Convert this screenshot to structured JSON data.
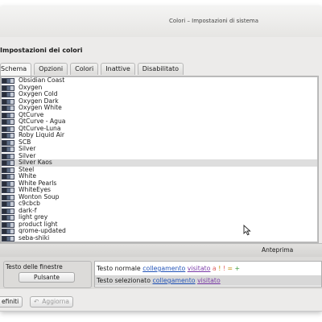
{
  "window": {
    "title": "Colori – Impostazioni di sistema"
  },
  "heading": "Impostazioni dei colori",
  "tabs": [
    {
      "label": "Schema",
      "active": true
    },
    {
      "label": "Opzioni",
      "active": false
    },
    {
      "label": "Colori",
      "active": false
    },
    {
      "label": "Inattive",
      "active": false
    },
    {
      "label": "Disabilitato",
      "active": false
    }
  ],
  "schemes": [
    {
      "name": "Obsidian Coast",
      "selected": false
    },
    {
      "name": "Oxygen",
      "selected": false
    },
    {
      "name": "Oxygen Cold",
      "selected": false
    },
    {
      "name": "Oxygen Dark",
      "selected": false
    },
    {
      "name": "Oxygen White",
      "selected": false
    },
    {
      "name": "QtCurve",
      "selected": false
    },
    {
      "name": "QtCurve - Agua",
      "selected": false
    },
    {
      "name": "QtCurve-Luna",
      "selected": false
    },
    {
      "name": "Roby Liquid Air",
      "selected": false
    },
    {
      "name": "SCB",
      "selected": false
    },
    {
      "name": "Silver",
      "selected": false
    },
    {
      "name": "Silver",
      "selected": false
    },
    {
      "name": "Silver Kaos",
      "selected": true
    },
    {
      "name": "Steel",
      "selected": false
    },
    {
      "name": "White",
      "selected": false
    },
    {
      "name": "White Pearls",
      "selected": false
    },
    {
      "name": "WhiteEyes",
      "selected": false
    },
    {
      "name": "Wonton Soup",
      "selected": false
    },
    {
      "name": "c9cbcb",
      "selected": false
    },
    {
      "name": "dark-f",
      "selected": false
    },
    {
      "name": "light grey",
      "selected": false
    },
    {
      "name": "product light",
      "selected": false
    },
    {
      "name": "qrome-updated",
      "selected": false
    },
    {
      "name": "seba-shiki",
      "selected": false
    }
  ],
  "preview": {
    "header": "Anteprima",
    "window_text_label": "Testo delle finestre",
    "button_label": "Pulsante",
    "normal": {
      "label": "Testo normale",
      "link": "collegamento",
      "visited": "visitato",
      "neg": "a",
      "neu": "!",
      "pos": "=",
      "plus": "+"
    },
    "selected": {
      "label": "Testo selezionato",
      "link": "collegamento",
      "visited": "visitato"
    }
  },
  "bottom": {
    "defaults_label": "efiniti",
    "apply_label": "Aggiorna"
  },
  "colors": {
    "link": "#2253b8",
    "visited": "#7a3aa8",
    "selection": "#dedede"
  }
}
